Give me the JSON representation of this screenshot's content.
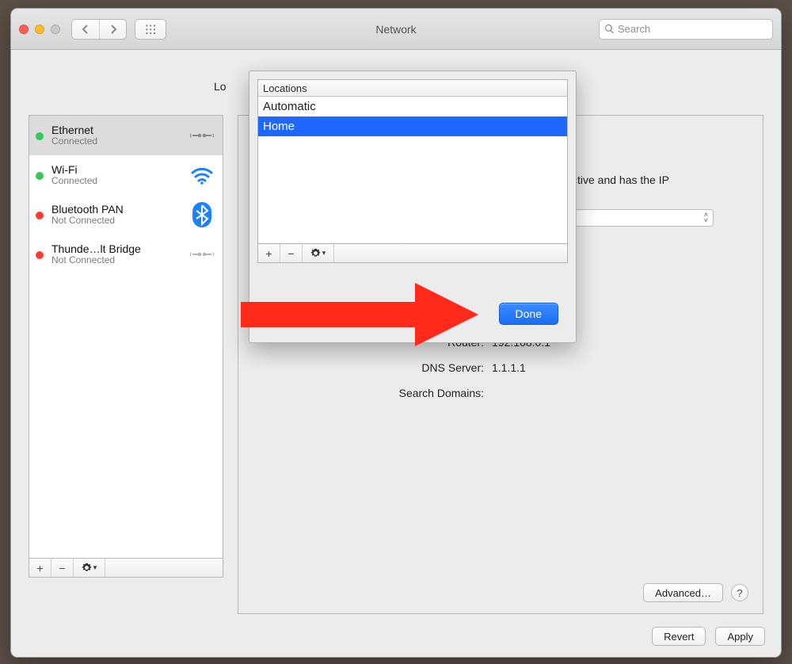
{
  "window": {
    "title": "Network"
  },
  "search": {
    "placeholder": "Search"
  },
  "location": {
    "label_fragment_left": "Lo",
    "stepper_glyph_up": "˄",
    "stepper_glyph_down": "˅"
  },
  "sidebar": {
    "services": [
      {
        "name": "Ethernet",
        "status": "Connected",
        "status_color": "green",
        "icon": "ethernet",
        "selected": true
      },
      {
        "name": "Wi-Fi",
        "status": "Connected",
        "status_color": "green",
        "icon": "wifi",
        "selected": false
      },
      {
        "name": "Bluetooth PAN",
        "status": "Not Connected",
        "status_color": "red",
        "icon": "bluetooth",
        "selected": false
      },
      {
        "name": "Thunde…lt Bridge",
        "status": "Not Connected",
        "status_color": "red",
        "icon": "ethernet-grey",
        "selected": false
      }
    ],
    "add_label": "+",
    "remove_label": "−"
  },
  "detail": {
    "status_partial_right": "ctive and has the IP",
    "rows": {
      "router_label": "Router:",
      "router_value": "192.168.0.1",
      "dns_label": "DNS Server:",
      "dns_value": "1.1.1.1",
      "search_domains_label": "Search Domains:",
      "search_domains_value": ""
    },
    "advanced_label": "Advanced…",
    "help_label": "?"
  },
  "footer": {
    "revert_label": "Revert",
    "apply_label": "Apply"
  },
  "popover": {
    "header": "Locations",
    "items": [
      {
        "label": "Automatic",
        "selected": false
      },
      {
        "label": "Home",
        "selected": true
      }
    ],
    "add_label": "+",
    "remove_label": "−",
    "done_label": "Done"
  }
}
